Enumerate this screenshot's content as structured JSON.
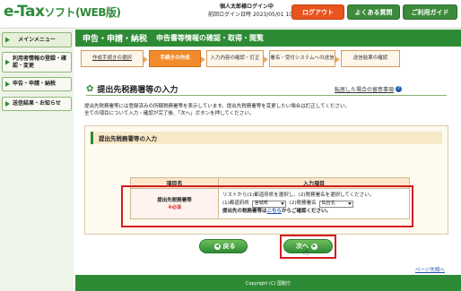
{
  "header": {
    "logo_main": "e-Tax",
    "logo_sub": "ソフト(WEB版)",
    "user_name": "個人太郎様ログイン中",
    "last_login_label": "前回ログイン日時",
    "last_login_value": "2023/05/01 10:29",
    "logout": "ログアウト",
    "faq": "よくある質問",
    "guide": "ご利用ガイド"
  },
  "sidebar": {
    "menu": "メインメニュー",
    "items": [
      {
        "label": "利用者情報の登録・確認・変更"
      },
      {
        "label": "申告・申請・納税"
      },
      {
        "label": "送信結果・お知らせ"
      }
    ]
  },
  "title_bar": {
    "section": "申告・申請・納税",
    "page": "申告書等情報の確認・取得・閲覧"
  },
  "steps": [
    {
      "label": "作成手続きの選択"
    },
    {
      "label": "手続きの作成"
    },
    {
      "label": "入力内容の確認・訂正"
    },
    {
      "label": "署名・受付システムへの送信"
    },
    {
      "label": "送信結果の確認"
    }
  ],
  "page_title": "提出先税務署等の入力",
  "help_link": "転居した場合の留意事項",
  "description": [
    "提出先税務署等には登録済みの所轄税務署等を表示しています。提出先税務署等を変更したい場合は訂正してください。",
    "全ての項目について入力・確認が完了後、「次へ」ボタンを押してください。"
  ],
  "section_title": "提出先税務署等の入力",
  "table": {
    "col1": "項目名",
    "col2": "入力項目",
    "label": "提出先税務署等",
    "required": "※必須",
    "instruction": "リストから(1)都道府県を選択し、(2)税務署名を選択してください。",
    "pref_label": "(1)都道府県",
    "pref_value": "宮城県",
    "office_label": "(2)税務署名",
    "office_value": "仙台北",
    "note_prefix": "提出先の税務署等は",
    "note_link": "こちら",
    "note_suffix": "からご確認ください。"
  },
  "buttons": {
    "back": "戻る",
    "next": "次へ"
  },
  "page_top": "ページ先頭へ",
  "footer": "Copyright (C) 国税庁"
}
